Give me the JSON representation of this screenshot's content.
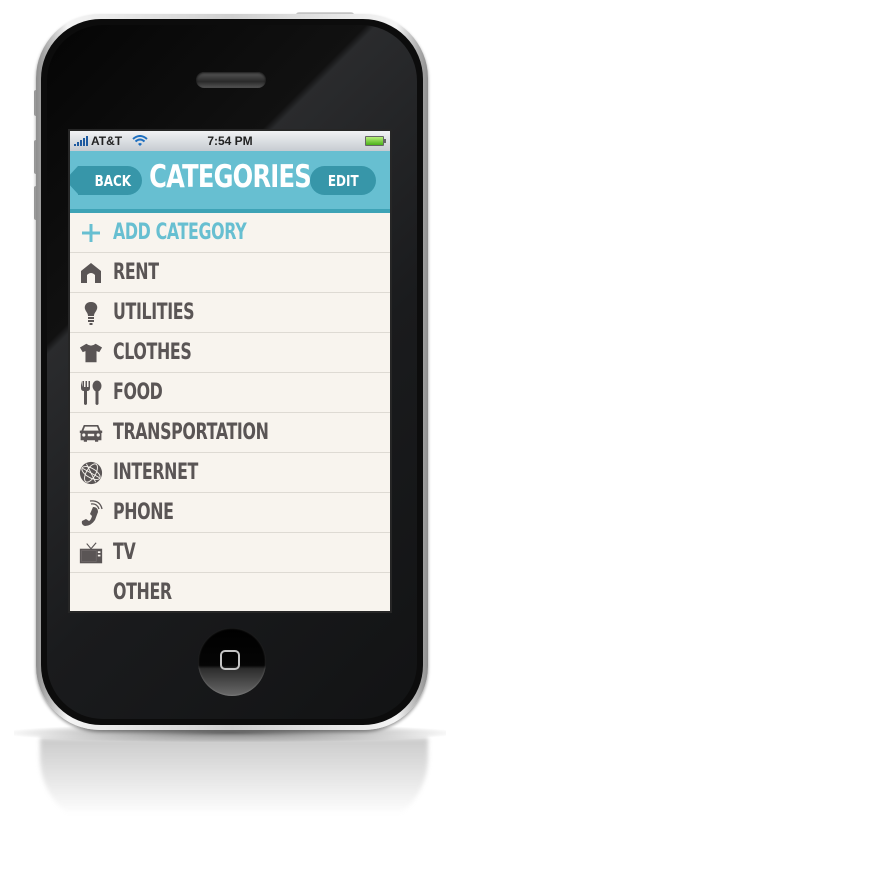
{
  "status_bar": {
    "carrier": "AT&T",
    "time": "7:54 PM",
    "signal_icon": "signal-bars-icon",
    "wifi_icon": "wifi-icon",
    "battery_icon": "battery-icon"
  },
  "nav": {
    "title": "CATEGORIES",
    "back_label": "BACK",
    "edit_label": "EDIT"
  },
  "colors": {
    "accent": "#67bfd1",
    "button": "#3796a9",
    "list_background": "#f8f4ee",
    "item_text": "#5a5555"
  },
  "list": {
    "add_item": {
      "label": "ADD CATEGORY",
      "icon": "plus-icon"
    },
    "items": [
      {
        "label": "RENT",
        "icon": "house-icon"
      },
      {
        "label": "UTILITIES",
        "icon": "lightbulb-icon"
      },
      {
        "label": "CLOTHES",
        "icon": "shirt-icon"
      },
      {
        "label": "FOOD",
        "icon": "fork-spoon-icon"
      },
      {
        "label": "TRANSPORTATION",
        "icon": "car-icon"
      },
      {
        "label": "INTERNET",
        "icon": "globe-icon"
      },
      {
        "label": "PHONE",
        "icon": "phone-icon"
      },
      {
        "label": "TV",
        "icon": "tv-icon"
      },
      {
        "label": "OTHER",
        "icon": ""
      }
    ]
  }
}
